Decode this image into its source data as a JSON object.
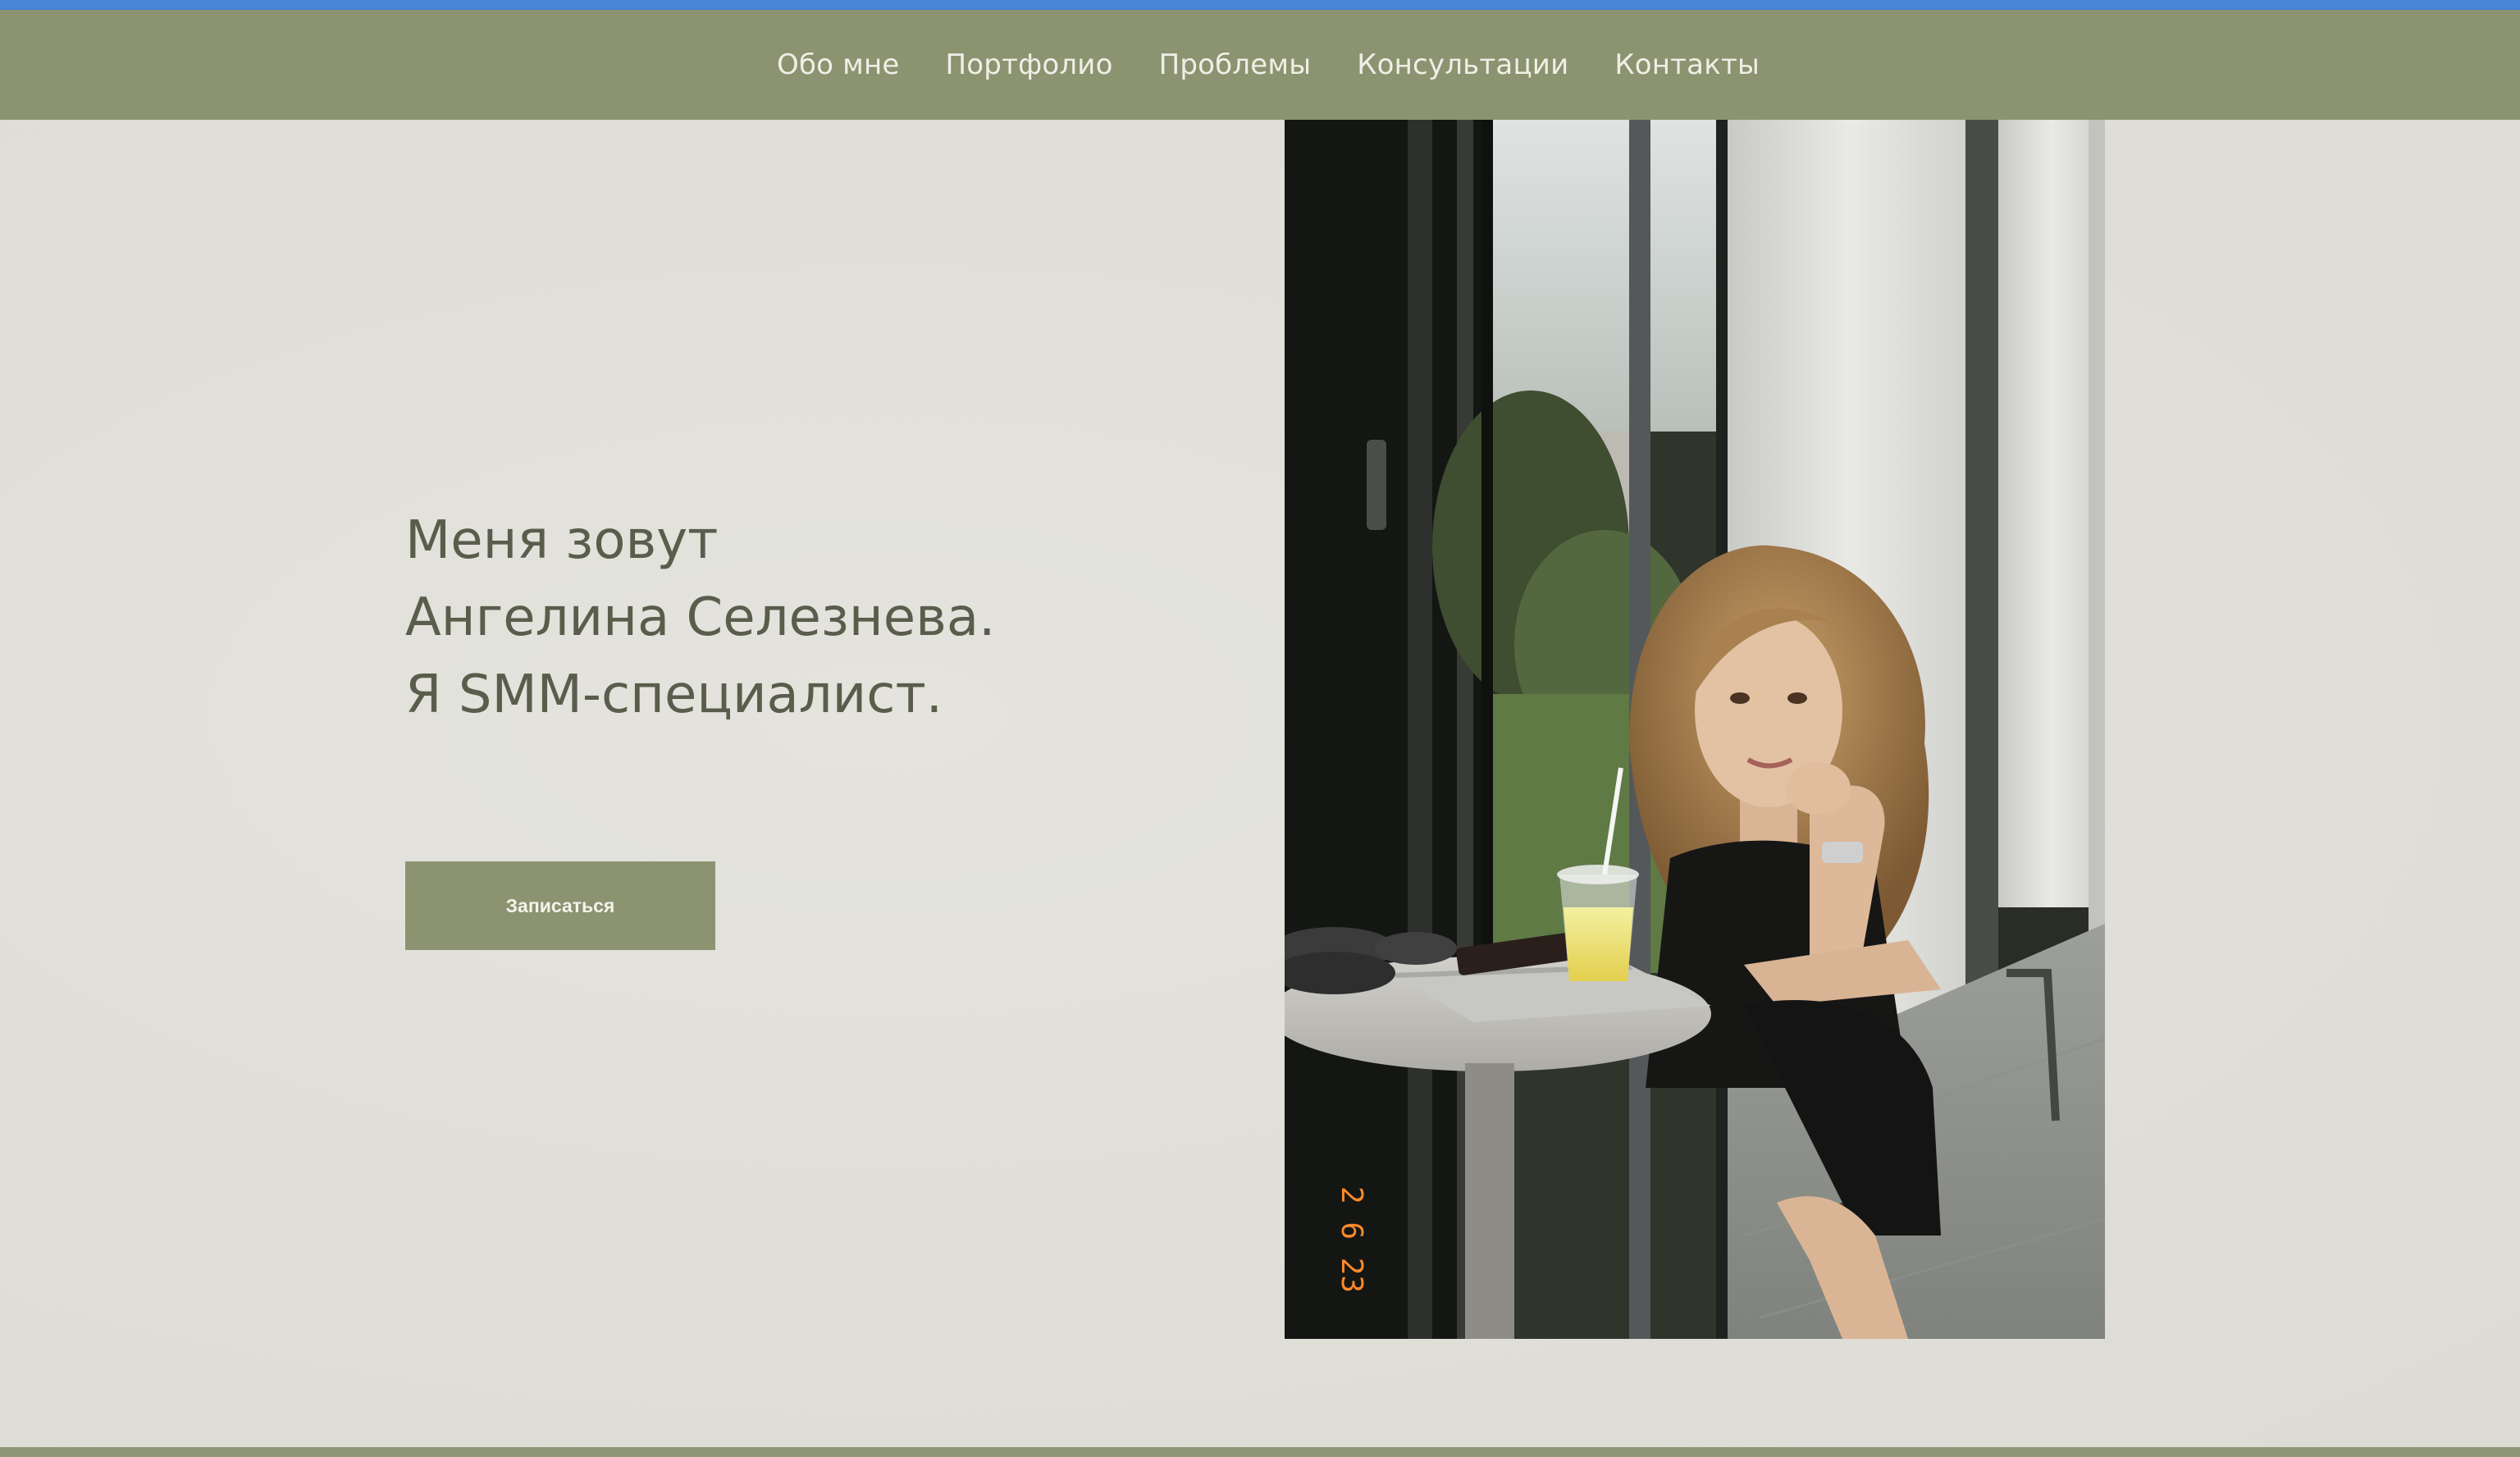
{
  "nav": {
    "items": [
      {
        "label": "Обо мне"
      },
      {
        "label": "Портфолио"
      },
      {
        "label": "Проблемы"
      },
      {
        "label": "Консультации"
      },
      {
        "label": "Контакты"
      }
    ]
  },
  "hero": {
    "lines": [
      "Меня зовут",
      "Ангелина Селезнева.",
      "Я SMM-специалист."
    ],
    "cta_label": "Записаться"
  },
  "photo": {
    "date_stamp": "2 6 23"
  },
  "colors": {
    "accent": "#8c9370",
    "background": "#e0dfd9",
    "text": "#5a5d4b",
    "browser_strip": "#4a86d8"
  }
}
